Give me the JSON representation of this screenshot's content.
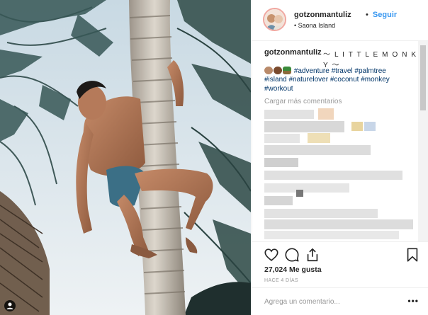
{
  "post": {
    "username": "gotzonmantuliz",
    "follow_separator": "•",
    "follow_label": "Seguir",
    "location": "• Saona Island"
  },
  "caption": {
    "username": "gotzonmantuliz",
    "title": "〜 L I T T L E M O N K E Y 〜",
    "hashtags_line1": "#adventure #travel #palmtree",
    "hashtags_line2": "#island #naturelover #coconut #monkey",
    "hashtags_line3": "#workout",
    "emoji_icons": [
      "coconut-emoji",
      "monkey-emoji",
      "palm-tree-emoji"
    ]
  },
  "load_more_comments": "Cargar más comentarios",
  "likes": "27,024 Me gusta",
  "timestamp": "HACE 4 DÍAS",
  "add_comment_placeholder": "Agrega un comentario...",
  "more_options": "•••",
  "icons": {
    "like": "heart-icon",
    "comment": "comment-icon",
    "share": "share-icon",
    "save": "bookmark-icon",
    "tag": "user-tag-icon"
  },
  "colors": {
    "link": "#3897f0",
    "hashtag": "#003569",
    "muted": "#999999",
    "text": "#262626"
  }
}
